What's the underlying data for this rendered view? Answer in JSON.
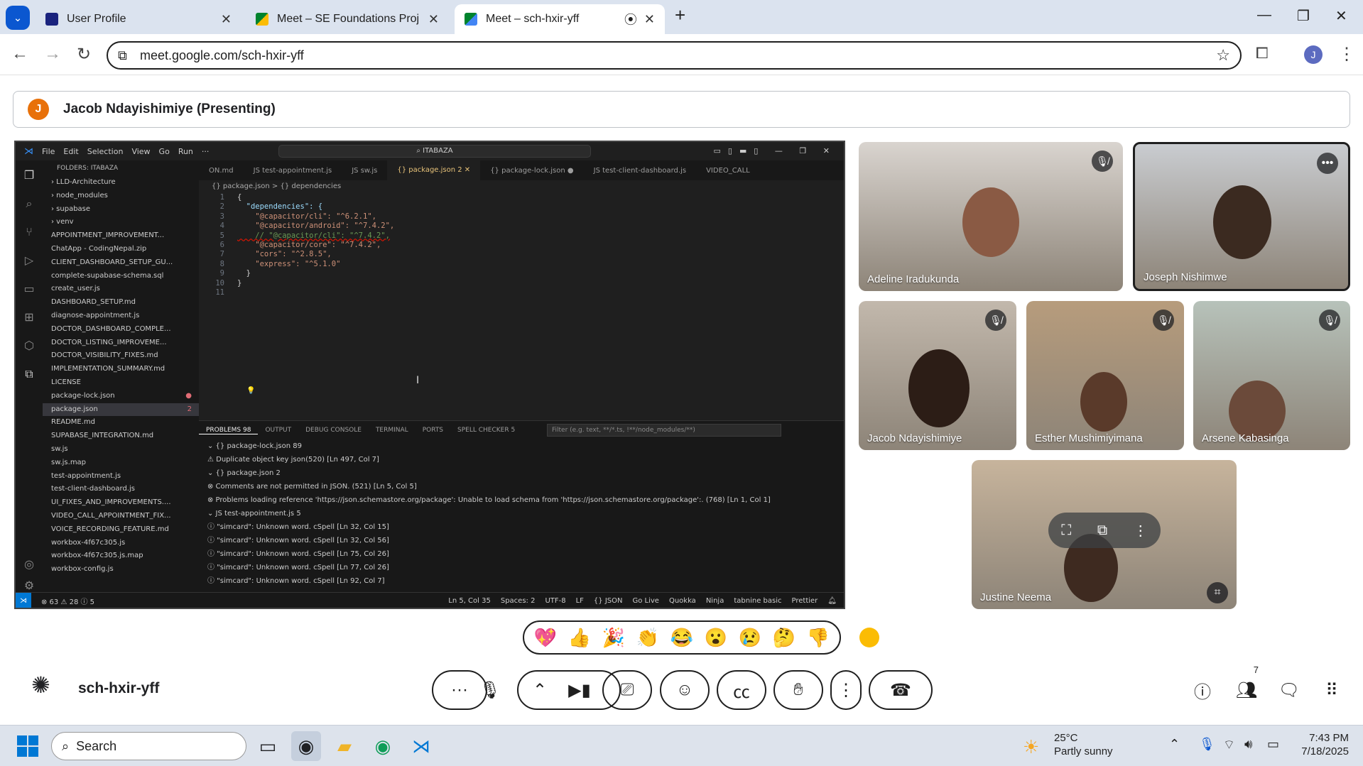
{
  "browser": {
    "tabs": [
      {
        "title": "User Profile",
        "close": "✕"
      },
      {
        "title": "Meet – SE Foundations Proj",
        "close": "✕"
      },
      {
        "title": "Meet – sch-hxir-yff",
        "close": "✕"
      }
    ],
    "new_tab": "+",
    "url": "meet.google.com/sch-hxir-yff",
    "profile_initial": "J"
  },
  "presenter": {
    "initial": "J",
    "label": "Jacob Ndayishimiye (Presenting)"
  },
  "vscode": {
    "menu": [
      "File",
      "Edit",
      "Selection",
      "View",
      "Go",
      "Run",
      "···"
    ],
    "search": "ITABAZA",
    "explorer_header": "FOLDERS: ITABAZA",
    "files": [
      {
        "name": "› LLD-Architecture"
      },
      {
        "name": "› node_modules"
      },
      {
        "name": "› supabase"
      },
      {
        "name": "› venv"
      },
      {
        "name": "APPOINTMENT_IMPROVEMENT..."
      },
      {
        "name": "ChatApp - CodingNepal.zip"
      },
      {
        "name": "CLIENT_DASHBOARD_SETUP_GU..."
      },
      {
        "name": "complete-supabase-schema.sql"
      },
      {
        "name": "create_user.js"
      },
      {
        "name": "DASHBOARD_SETUP.md"
      },
      {
        "name": "diagnose-appointment.js"
      },
      {
        "name": "DOCTOR_DASHBOARD_COMPLE..."
      },
      {
        "name": "DOCTOR_LISTING_IMPROVEME..."
      },
      {
        "name": "DOCTOR_VISIBILITY_FIXES.md"
      },
      {
        "name": "IMPLEMENTATION_SUMMARY.md"
      },
      {
        "name": "LICENSE"
      },
      {
        "name": "package-lock.json",
        "badge": "●"
      },
      {
        "name": "package.json",
        "badge": "2",
        "selected": true
      },
      {
        "name": "README.md"
      },
      {
        "name": "SUPABASE_INTEGRATION.md"
      },
      {
        "name": "sw.js"
      },
      {
        "name": "sw.js.map"
      },
      {
        "name": "test-appointment.js"
      },
      {
        "name": "test-client-dashboard.js"
      },
      {
        "name": "UI_FIXES_AND_IMPROVEMENTS...."
      },
      {
        "name": "VIDEO_CALL_APPOINTMENT_FIX..."
      },
      {
        "name": "VOICE_RECORDING_FEATURE.md"
      },
      {
        "name": "workbox-4f67c305.js"
      },
      {
        "name": "workbox-4f67c305.js.map"
      },
      {
        "name": "workbox-config.js"
      }
    ],
    "editor_tabs": [
      {
        "label": "ON.md"
      },
      {
        "label": "JS test-appointment.js"
      },
      {
        "label": "JS sw.js"
      },
      {
        "label": "{} package.json 2 ✕",
        "active": true
      },
      {
        "label": "{} package-lock.json ●"
      },
      {
        "label": "JS test-client-dashboard.js"
      },
      {
        "label": "VIDEO_CALL"
      }
    ],
    "breadcrumb": "{} package.json > {} dependencies",
    "code_lines": [
      {
        "n": "1",
        "t": "{"
      },
      {
        "n": "2",
        "t": "  \"dependencies\": {"
      },
      {
        "n": "3",
        "t": "    \"@capacitor/cli\": \"^6.2.1\","
      },
      {
        "n": "4",
        "t": "    \"@capacitor/android\": \"^7.4.2\","
      },
      {
        "n": "5",
        "t": "    // \"@capacitor/cli\": \"^7.4.2\","
      },
      {
        "n": "6",
        "t": "    \"@capacitor/core\": \"^7.4.2\","
      },
      {
        "n": "7",
        "t": "    \"cors\": \"^2.8.5\","
      },
      {
        "n": "8",
        "t": "    \"express\": \"^5.1.0\""
      },
      {
        "n": "9",
        "t": "  }"
      },
      {
        "n": "10",
        "t": "}"
      },
      {
        "n": "11",
        "t": ""
      }
    ],
    "panel_tabs": [
      "PROBLEMS 98",
      "OUTPUT",
      "DEBUG CONSOLE",
      "TERMINAL",
      "PORTS",
      "SPELL CHECKER 5"
    ],
    "panel_filter": "Filter (e.g. text, **/*.ts, !**/node_modules/**)",
    "problems": [
      {
        "text": "⌄ {} package-lock.json  89"
      },
      {
        "text": "      ⚠ Duplicate object key  json(520)  [Ln 497, Col 7]"
      },
      {
        "text": "⌄ {} package.json  2"
      },
      {
        "text": "      ⊗ Comments are not permitted in JSON.  (521)  [Ln 5, Col 5]"
      },
      {
        "text": "      ⊗ Problems loading reference 'https://json.schemastore.org/package': Unable to load schema from 'https://json.schemastore.org/package':.  (768)  [Ln 1, Col 1]"
      },
      {
        "text": "⌄ JS test-appointment.js  5"
      },
      {
        "text": "      ⓘ \"simcard\": Unknown word.  cSpell  [Ln 32, Col 15]"
      },
      {
        "text": "      ⓘ \"simcard\": Unknown word.  cSpell  [Ln 32, Col 56]"
      },
      {
        "text": "      ⓘ \"simcard\": Unknown word.  cSpell  [Ln 75, Col 26]"
      },
      {
        "text": "      ⓘ \"simcard\": Unknown word.  cSpell  [Ln 77, Col 26]"
      },
      {
        "text": "      ⓘ \"simcard\": Unknown word.  cSpell  [Ln 92, Col 7]"
      }
    ],
    "status_left": "⊗ 63 ⚠ 28 ⓘ 5",
    "status_right": [
      "Ln 5, Col 35",
      "Spaces: 2",
      "UTF-8",
      "LF",
      "{} JSON",
      "Go Live",
      "Quokka",
      "Ninja",
      "tabnine basic",
      "Prettier"
    ]
  },
  "participants": [
    {
      "name": "Adeline Iradukunda",
      "muted": true,
      "bg": "#d9d4cf",
      "skin": "#8a5a44"
    },
    {
      "name": "Joseph Nishimwe",
      "muted": false,
      "bg": "#c9ccd0",
      "skin": "#3b2a20"
    },
    {
      "name": "Jacob Ndayishimiye",
      "muted": true,
      "bg": "#c2b8ac",
      "skin": "#2c1d16"
    },
    {
      "name": "Esther Mushimiyimana",
      "muted": true,
      "bg": "#b79c7c",
      "skin": "#5a3a2a"
    },
    {
      "name": "Arsene Kabasinga",
      "muted": true,
      "bg": "#b7c2ba",
      "skin": "#6b4a3a"
    },
    {
      "name": "Justine Neema",
      "muted": false,
      "bg": "#c7b49c",
      "skin": "#3e2a20"
    }
  ],
  "reactions": [
    "💖",
    "👍",
    "🎉",
    "👏",
    "😂",
    "😮",
    "😢",
    "🤔",
    "👎"
  ],
  "meeting_code": "sch-hxir-yff",
  "people_count": "7",
  "taskbar": {
    "search": "Search",
    "temp": "25°C",
    "weather": "Partly sunny",
    "time": "7:43 PM",
    "date": "7/18/2025"
  }
}
